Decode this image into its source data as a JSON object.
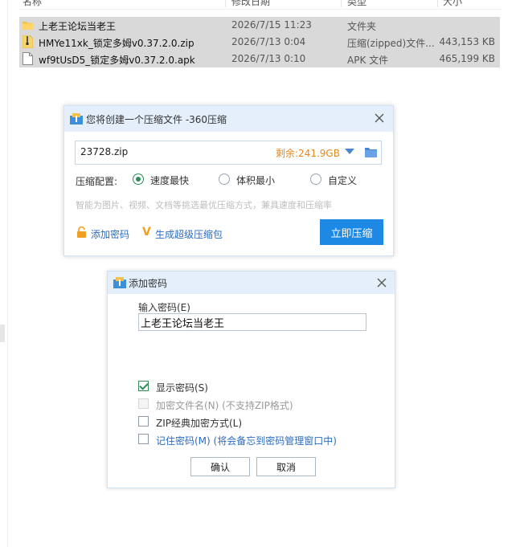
{
  "explorer": {
    "columns": [
      "名称",
      "修改日期",
      "类型",
      "大小"
    ],
    "files": [
      {
        "name": "上老王论坛当老王",
        "date": "2026/7/15 11:23",
        "type": "文件夹",
        "size": "",
        "icon": "folder-icon"
      },
      {
        "name": "HMYe11xk_锁定多姆v0.37.2.0.zip",
        "date": "2026/7/13 0:04",
        "type": "压缩(zipped)文件...",
        "size": "443,153 KB",
        "icon": "zip-file-icon"
      },
      {
        "name": "wf9tUsD5_锁定多姆v0.37.2.0.apk",
        "date": "2026/7/13 0:10",
        "type": "APK 文件",
        "size": "465,199 KB",
        "icon": "file-icon"
      }
    ]
  },
  "compress_dialog": {
    "title": "您将创建一个压缩文件 -360压缩",
    "filename": "23728.zip",
    "free_space": "剩余:241.9GB",
    "config_label": "压缩配置:",
    "options": [
      {
        "label": "速度最快",
        "selected": true
      },
      {
        "label": "体积最小",
        "selected": false
      },
      {
        "label": "自定义",
        "selected": false
      }
    ],
    "hint": "智能为图片、视频、文档等挑选最优压缩方式，兼具速度和压缩率",
    "add_password_link": "添加密码",
    "sfx_link": "生成超级压缩包",
    "compress_button": "立即压缩"
  },
  "password_dialog": {
    "title": "添加密码",
    "input_label": "输入密码(E)",
    "password_value": "上老王论坛当老王",
    "checkboxes": [
      {
        "label": "显示密码(S)",
        "checked": true,
        "enabled": true
      },
      {
        "label": "加密文件名(N) (不支持ZIP格式)",
        "checked": false,
        "enabled": false
      },
      {
        "label": "ZIP经典加密方式(L)",
        "checked": false,
        "enabled": true
      },
      {
        "label": "记住密码(M) (将会备忘到密码管理窗口中)",
        "checked": false,
        "enabled": true
      }
    ],
    "ok_button": "确认",
    "cancel_button": "取消"
  },
  "colors": {
    "accent_blue": "#1e88e5",
    "link_blue": "#2b6cc0",
    "free_space_orange": "#e48a1a",
    "check_green": "#2e8b57",
    "titlebar_bg": "#e4effb",
    "row_selected": "#d9d9d9"
  }
}
